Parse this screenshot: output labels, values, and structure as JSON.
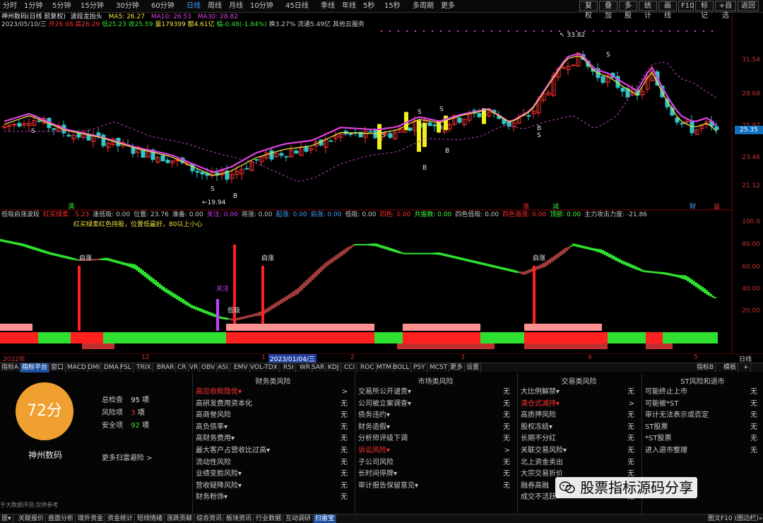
{
  "period_tabs": [
    "分时",
    "1分钟",
    "5分钟",
    "15分钟",
    "30分钟",
    "60分钟",
    "日线",
    "周线",
    "月线",
    "10分钟",
    "45日线",
    "季线",
    "年线",
    "5秒",
    "15秒",
    "多周期",
    "更多"
  ],
  "active_period": "日线",
  "right_buttons": [
    "复权",
    "叠加",
    "多股",
    "统计",
    "画线",
    "F10",
    "标记",
    "+自选",
    "返回"
  ],
  "stock": {
    "title": "神州数码(日线 前复权)",
    "indicator": "波段龙抬头",
    "ma5": "MA5: 26.27",
    "ma10": "MA10: 26.53",
    "ma30": "MA30: 28.82",
    "date": "2023/05/10/三",
    "open": "开26.08",
    "high": "高26.29",
    "low": "低25.23",
    "close": "收25.59",
    "volume": "量179399",
    "amount": "额4.61亿",
    "change": "幅-0.48(-1.84%)",
    "turnover": "换3.27%",
    "float": "流通5.49亿",
    "other": "其他云服务"
  },
  "price_axis": [
    "31.54",
    "28.68",
    "25.87",
    "23.46",
    "21.12"
  ],
  "current_price": "25.35",
  "annotations": {
    "high_mark": "33.82",
    "low_mark": "19.94",
    "sub_top_label": "红买绿卖红色持股，位置低最好，80以上小心",
    "qizhang": "启涨",
    "guanzhu": "关注",
    "diji": "低吸",
    "ques_label": "涨",
    "jian": "减",
    "cai": "财",
    "yi": "益",
    "mai": "满",
    "s_label": "S",
    "b_label": "B"
  },
  "sub_info": [
    {
      "text": "低吸启涨波段",
      "color": "#c8c8c8"
    },
    {
      "text": "红买绿卖: -5.23",
      "color": "#ff3030"
    },
    {
      "text": "逢低吸: 0.00",
      "color": "#c8c8c8"
    },
    {
      "text": "位置: 23.76",
      "color": "#c8c8c8"
    },
    {
      "text": "准备: 0.00",
      "color": "#c8c8c8"
    },
    {
      "text": "关注: 0.00",
      "color": "#d040ff"
    },
    {
      "text": "将涨: 0.00",
      "color": "#c8c8c8"
    },
    {
      "text": "起涨: 0.00",
      "color": "#40a0ff"
    },
    {
      "text": "启涨: 0.00",
      "color": "#40a0ff"
    },
    {
      "text": "低吸: 0.00",
      "color": "#c8c8c8"
    },
    {
      "text": "四色: 0.00",
      "color": "#ff3030"
    },
    {
      "text": "共振数: 0.00",
      "color": "#40ff40"
    },
    {
      "text": "四色低吸: 0.00",
      "color": "#c8c8c8"
    },
    {
      "text": "四色追涨: 0.00",
      "color": "#ff3030"
    },
    {
      "text": "顶部: 0.00",
      "color": "#40ff40"
    },
    {
      "text": "主力攻击力度: -21.86",
      "color": "#c8c8c8"
    }
  ],
  "sub_axis": [
    "100.0",
    "80.00",
    "60.00",
    "40.00",
    "20.00"
  ],
  "date_axis": {
    "y2022": "2022年",
    "m12": "12",
    "d1": "1",
    "sel": "2023/01/04/三",
    "m2": "2",
    "m3": "3",
    "m4": "4",
    "m5": "5",
    "right": "日线"
  },
  "indicator_tabs": [
    "指标A",
    "指标平台",
    "窗口",
    "MACD",
    "DMI",
    "DMA",
    "FSL",
    "TRIX",
    "BRAR",
    "CR",
    "VR",
    "OBV",
    "ASI",
    "EMV",
    "VOL-TDX",
    "RSI",
    "WR",
    "SAR",
    "KDJ",
    "CCI",
    "ROC",
    "MTM",
    "BOLL",
    "PSY",
    "MCST",
    "更多",
    "设置"
  ],
  "indicator_tabs_right": [
    "指标B",
    "模板",
    "+"
  ],
  "risk": {
    "score": "72分",
    "name": "神州数码",
    "total_label": "总检查",
    "total_val": "95",
    "total_unit": "项",
    "risk_label": "风险项",
    "risk_val": "3",
    "risk_unit": "项",
    "safe_label": "安全项",
    "safe_val": "92",
    "safe_unit": "项",
    "more": "更多扫雷避险 >",
    "footnote": "于大数据评测,仅供参考",
    "watermark": "股票指标源码分享",
    "columns": [
      {
        "title": "财务类风险",
        "rows": [
          {
            "label": "高应收款隐忧▾",
            "status": ">",
            "hot": true
          },
          {
            "label": "高研发费用资本化",
            "status": "无"
          },
          {
            "label": "高商誉风险",
            "status": "无"
          },
          {
            "label": "高负债率▾",
            "status": "无"
          },
          {
            "label": "高财务费用▾",
            "status": "无"
          },
          {
            "label": "最大客户占营收比过高▾",
            "status": "无"
          },
          {
            "label": "流动性风险",
            "status": "无"
          },
          {
            "label": "业绩变脸风险▾",
            "status": "无"
          },
          {
            "label": "营收疑降风险▾",
            "status": "无"
          },
          {
            "label": "财务粉饰▾",
            "status": "无"
          }
        ]
      },
      {
        "title": "市场类风险",
        "rows": [
          {
            "label": "交易所公开谴责▾",
            "status": "无"
          },
          {
            "label": "公司被立案调查▾",
            "status": "无"
          },
          {
            "label": "债务违约▾",
            "status": "无"
          },
          {
            "label": "财务造假▾",
            "status": "无"
          },
          {
            "label": "分析师评级下调",
            "status": "无"
          },
          {
            "label": "诉讼风险▾",
            "status": ">",
            "hot": true
          },
          {
            "label": "子公司风险",
            "status": "无"
          },
          {
            "label": "长时间停牌▾",
            "status": "无"
          },
          {
            "label": "审计报告保留意见▾",
            "status": "无"
          }
        ]
      },
      {
        "title": "交易类风险",
        "rows": [
          {
            "label": "大比例解禁▾",
            "status": "无"
          },
          {
            "label": "清仓式减持▾",
            "status": ">",
            "hot": true
          },
          {
            "label": "高质押风险",
            "status": "无"
          },
          {
            "label": "股权冻结▾",
            "status": "无"
          },
          {
            "label": "长期不分红",
            "status": "无"
          },
          {
            "label": "关联交易风险▾",
            "status": "无"
          },
          {
            "label": "北上资金卖出",
            "status": "无"
          },
          {
            "label": "大宗交易折价",
            "status": "无"
          },
          {
            "label": "融券高融",
            "status": "无"
          },
          {
            "label": "成交不活跃▾",
            "status": "无"
          }
        ]
      },
      {
        "title": "ST风险和退市",
        "rows": [
          {
            "label": "可能终止上市",
            "status": "无"
          },
          {
            "label": "可能被*ST",
            "status": "无"
          },
          {
            "label": "审计无法表示或否定",
            "status": "无"
          },
          {
            "label": "ST股票",
            "status": "无"
          },
          {
            "label": "*ST股票",
            "status": "无"
          },
          {
            "label": "进入退市整理",
            "status": "无"
          }
        ]
      }
    ]
  },
  "bottom_tabs": [
    "居▾",
    "关联报价",
    "盘面分析",
    "境外资金",
    "资金统计",
    "短线情绪",
    "涨跌贡献",
    "综合资讯",
    "板块资讯",
    "行业数据",
    "互动调研",
    "扫雷宝"
  ],
  "bottom_right": [
    "图文F10",
    "(图边栏)»"
  ],
  "colors": {
    "up": "#ff3030",
    "down": "#2ec8c8",
    "ma_yellow": "#f0e040",
    "ma_magenta": "#e040e0",
    "green": "#30e030",
    "brown": "#a04040",
    "score_bg": "#f0a030"
  }
}
